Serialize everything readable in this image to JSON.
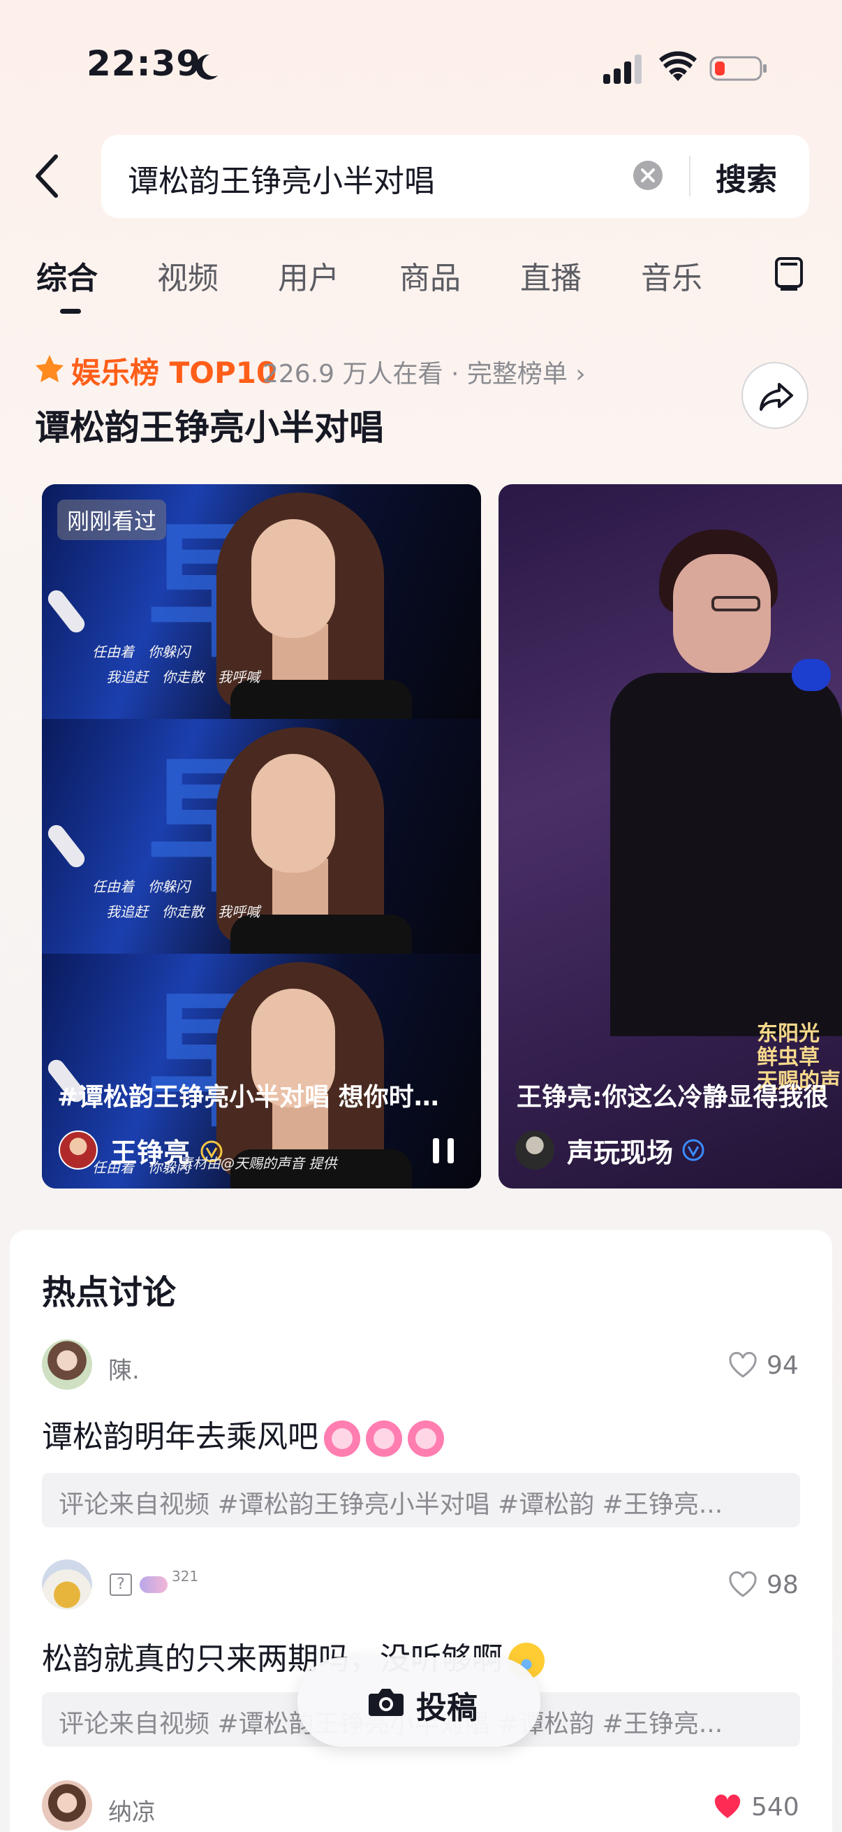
{
  "status": {
    "time": "22:39"
  },
  "search": {
    "query": "谭松韵王铮亮小半对唱",
    "button": "搜索"
  },
  "tabs": [
    {
      "label": "综合",
      "active": true
    },
    {
      "label": "视频"
    },
    {
      "label": "用户"
    },
    {
      "label": "商品"
    },
    {
      "label": "直播"
    },
    {
      "label": "音乐"
    }
  ],
  "ranking": {
    "label": "娱乐榜 TOP10",
    "meta": "226.9 万人在看 · 完整榜单 ›",
    "title": "谭松韵王铮亮小半对唱"
  },
  "videos": [
    {
      "badge": "刚刚看过",
      "caption": "#谭松韵王铮亮小半对唱 想你时…",
      "author": "王铮亮",
      "credit": "素材由@天赐的声音 提供",
      "lyric_line1": "任由着　你躲闪",
      "lyric_line2": "我追赶　你走散　我呼喊"
    },
    {
      "caption": "王铮亮:你这么冷静显得我很",
      "author": "声玩现场",
      "logo": "东阳光 鲜虫草 天赐的声"
    }
  ],
  "discussion": {
    "title": "热点讨论",
    "comments": [
      {
        "user": "陳.",
        "likes": "94",
        "text": "谭松韵明年去乘风吧",
        "source": "评论来自视频 #谭松韵王铮亮小半对唱  #谭松韵  #王铮亮...",
        "liked": false
      },
      {
        "user": "321",
        "likes": "98",
        "text": "松韵就真的只来两期吗，没听够啊",
        "source": "评论来自视频 #谭松韵王铮亮小半对唱  #谭松韵  #王铮亮...",
        "liked": false
      },
      {
        "user": "纳凉",
        "likes": "540",
        "liked": true
      }
    ]
  },
  "post_button": {
    "label": "投稿"
  },
  "colors": {
    "accent_orange": "#ff5e19",
    "like_red": "#fe2c55",
    "verify_blue": "#3b8cff"
  }
}
